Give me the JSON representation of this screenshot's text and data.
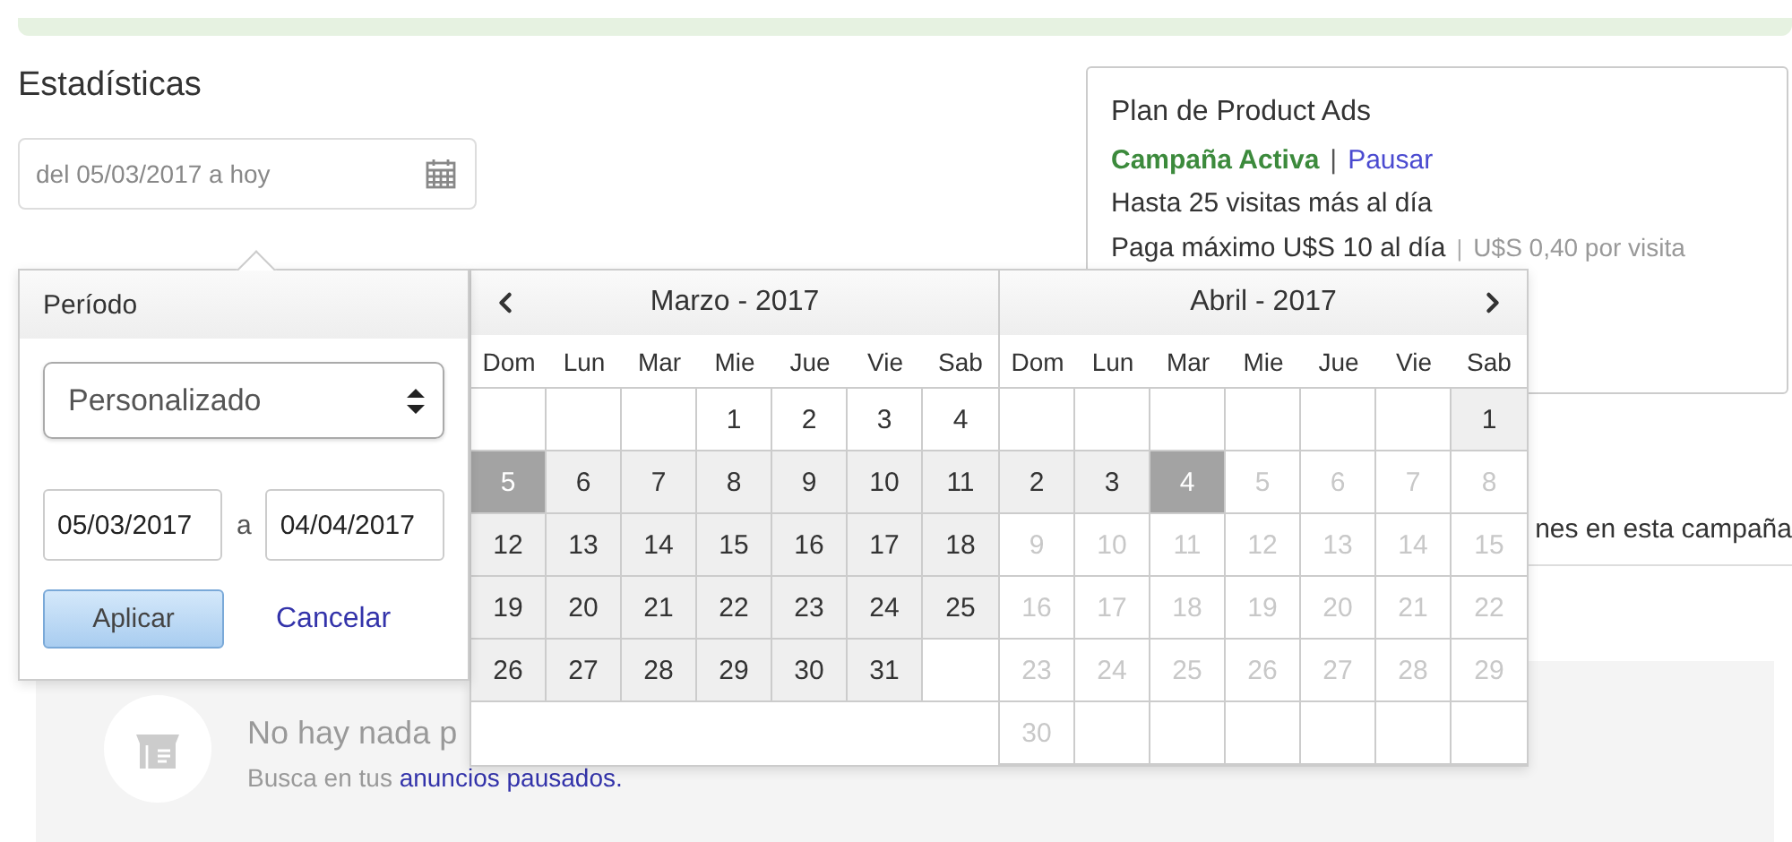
{
  "title": "Estadísticas",
  "date_field": {
    "value": "del 05/03/2017 a hoy"
  },
  "plan_card": {
    "title": "Plan de Product Ads",
    "status": "Campaña Activa",
    "separator": "|",
    "action": "Pausar",
    "visits": "Hasta 25 visitas más al día",
    "budget": "Paga máximo U$S 10 al día",
    "cost_separator": "|",
    "cost": "U$S 0,40 por visita"
  },
  "campaign_note": "nes en esta campaña",
  "empty_state": {
    "title": "No hay nada p",
    "text": "Busca en tus",
    "link": "anuncios pausados."
  },
  "period_panel": {
    "title": "Período",
    "preset": "Personalizado",
    "from": "05/03/2017",
    "joiner": "a",
    "to": "04/04/2017",
    "apply": "Aplicar",
    "cancel": "Cancelar"
  },
  "calendar": {
    "months": [
      {
        "title": "Marzo - 2017",
        "weekdays": [
          "Dom",
          "Lun",
          "Mar",
          "Mie",
          "Jue",
          "Vie",
          "Sab"
        ],
        "weeks": [
          [
            {
              "kind": "blank"
            },
            {
              "kind": "blank"
            },
            {
              "kind": "blank"
            },
            {
              "day": "1",
              "kind": "normal"
            },
            {
              "day": "2",
              "kind": "normal"
            },
            {
              "day": "3",
              "kind": "normal"
            },
            {
              "day": "4",
              "kind": "normal"
            }
          ],
          [
            {
              "day": "5",
              "kind": "selected"
            },
            {
              "day": "6",
              "kind": "range"
            },
            {
              "day": "7",
              "kind": "range"
            },
            {
              "day": "8",
              "kind": "range"
            },
            {
              "day": "9",
              "kind": "range"
            },
            {
              "day": "10",
              "kind": "range"
            },
            {
              "day": "11",
              "kind": "range"
            }
          ],
          [
            {
              "day": "12",
              "kind": "range"
            },
            {
              "day": "13",
              "kind": "range"
            },
            {
              "day": "14",
              "kind": "range"
            },
            {
              "day": "15",
              "kind": "range"
            },
            {
              "day": "16",
              "kind": "range"
            },
            {
              "day": "17",
              "kind": "range"
            },
            {
              "day": "18",
              "kind": "range"
            }
          ],
          [
            {
              "day": "19",
              "kind": "range"
            },
            {
              "day": "20",
              "kind": "range"
            },
            {
              "day": "21",
              "kind": "range"
            },
            {
              "day": "22",
              "kind": "range"
            },
            {
              "day": "23",
              "kind": "range"
            },
            {
              "day": "24",
              "kind": "range"
            },
            {
              "day": "25",
              "kind": "range"
            }
          ],
          [
            {
              "day": "26",
              "kind": "range"
            },
            {
              "day": "27",
              "kind": "range"
            },
            {
              "day": "28",
              "kind": "range"
            },
            {
              "day": "29",
              "kind": "range"
            },
            {
              "day": "30",
              "kind": "range"
            },
            {
              "day": "31",
              "kind": "range"
            },
            {
              "kind": "blank"
            }
          ]
        ]
      },
      {
        "title": "Abril - 2017",
        "weekdays": [
          "Dom",
          "Lun",
          "Mar",
          "Mie",
          "Jue",
          "Vie",
          "Sab"
        ],
        "weeks": [
          [
            {
              "kind": "blank"
            },
            {
              "kind": "blank"
            },
            {
              "kind": "blank"
            },
            {
              "kind": "blank"
            },
            {
              "kind": "blank"
            },
            {
              "kind": "blank"
            },
            {
              "day": "1",
              "kind": "range"
            }
          ],
          [
            {
              "day": "2",
              "kind": "range"
            },
            {
              "day": "3",
              "kind": "range"
            },
            {
              "day": "4",
              "kind": "selected"
            },
            {
              "day": "5",
              "kind": "disabled"
            },
            {
              "day": "6",
              "kind": "disabled"
            },
            {
              "day": "7",
              "kind": "disabled"
            },
            {
              "day": "8",
              "kind": "disabled"
            }
          ],
          [
            {
              "day": "9",
              "kind": "disabled"
            },
            {
              "day": "10",
              "kind": "disabled"
            },
            {
              "day": "11",
              "kind": "disabled"
            },
            {
              "day": "12",
              "kind": "disabled"
            },
            {
              "day": "13",
              "kind": "disabled"
            },
            {
              "day": "14",
              "kind": "disabled"
            },
            {
              "day": "15",
              "kind": "disabled"
            }
          ],
          [
            {
              "day": "16",
              "kind": "disabled"
            },
            {
              "day": "17",
              "kind": "disabled"
            },
            {
              "day": "18",
              "kind": "disabled"
            },
            {
              "day": "19",
              "kind": "disabled"
            },
            {
              "day": "20",
              "kind": "disabled"
            },
            {
              "day": "21",
              "kind": "disabled"
            },
            {
              "day": "22",
              "kind": "disabled"
            }
          ],
          [
            {
              "day": "23",
              "kind": "disabled"
            },
            {
              "day": "24",
              "kind": "disabled"
            },
            {
              "day": "25",
              "kind": "disabled"
            },
            {
              "day": "26",
              "kind": "disabled"
            },
            {
              "day": "27",
              "kind": "disabled"
            },
            {
              "day": "28",
              "kind": "disabled"
            },
            {
              "day": "29",
              "kind": "disabled"
            }
          ],
          [
            {
              "day": "30",
              "kind": "disabled"
            },
            {
              "kind": "blank"
            },
            {
              "kind": "blank"
            },
            {
              "kind": "blank"
            },
            {
              "kind": "blank"
            },
            {
              "kind": "blank"
            },
            {
              "kind": "blank"
            }
          ]
        ]
      }
    ]
  }
}
